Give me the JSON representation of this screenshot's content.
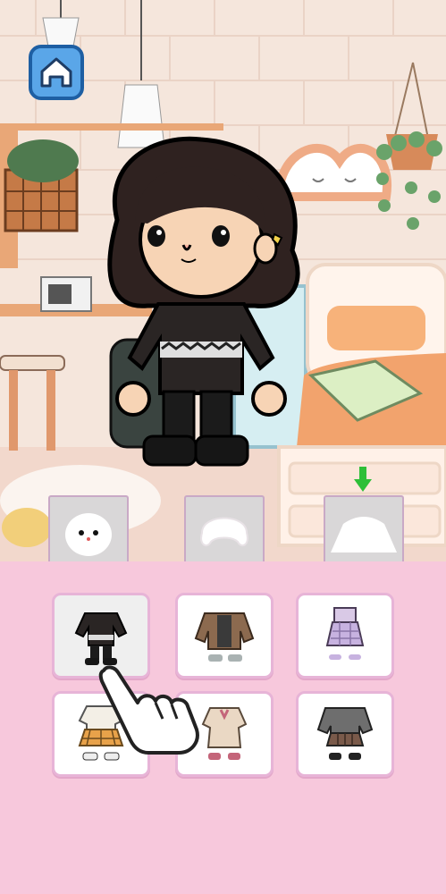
{
  "screen": "dress-up",
  "controls": {
    "home_button": {
      "icon": "house-icon"
    },
    "selection_indicator_icon": "green-arrow-down-icon",
    "tutorial_icon": "pointing-hand-icon"
  },
  "categories": [
    {
      "name": "face",
      "icon": "face-silhouette-icon",
      "selected": false
    },
    {
      "name": "hair",
      "icon": "hair-silhouette-icon",
      "selected": false
    },
    {
      "name": "clothes",
      "icon": "outfit-silhouette-icon",
      "selected": true
    }
  ],
  "outfits": [
    {
      "icon": "black-sweater-outfit-icon",
      "selected": true
    },
    {
      "icon": "brown-jacket-outfit-icon",
      "selected": false
    },
    {
      "icon": "lavender-plaid-dress-outfit-icon",
      "selected": false
    },
    {
      "icon": "plaid-orange-skirt-outfit-icon",
      "selected": false
    },
    {
      "icon": "beige-dress-outfit-icon",
      "selected": false
    },
    {
      "icon": "gray-jacket-plaid-skirt-outfit-icon",
      "selected": false
    }
  ],
  "colors": {
    "panel_background": "#f7c8dc",
    "card_border": "#e7b4d7",
    "home_button": "#5aa6e8",
    "indicator": "#2dbf38"
  }
}
